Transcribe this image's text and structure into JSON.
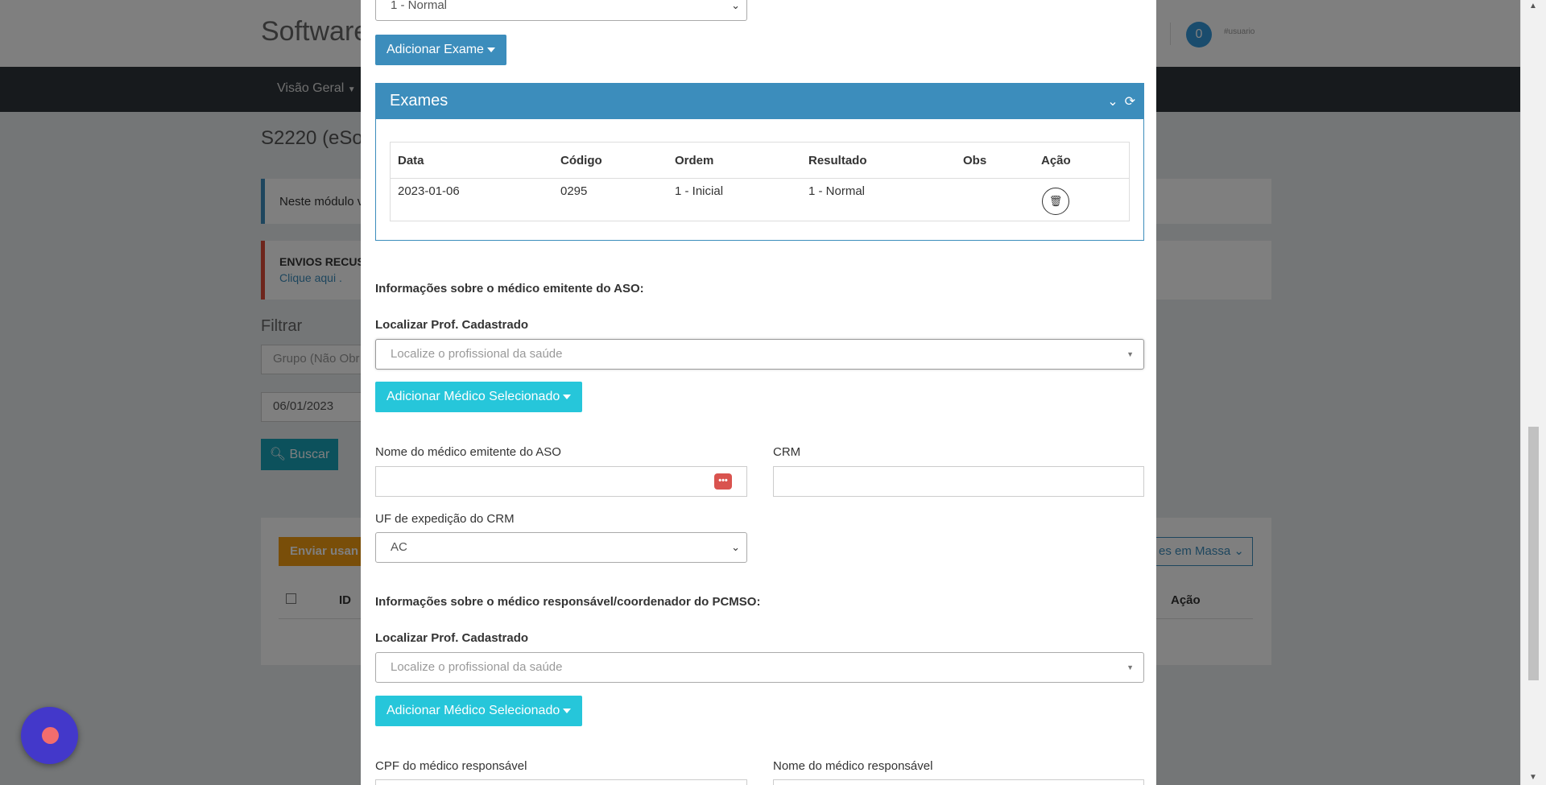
{
  "background": {
    "brand": "Software",
    "notif_count": "0",
    "user_label": "#usuario",
    "nav_item": "Visão Geral",
    "page_title": "S2220 (eSo",
    "info_text": "Neste módulo v",
    "alert_title": "ENVIOS RECUS",
    "alert_link": "Clique aqui .",
    "filter_title": "Filtrar",
    "group_placeholder": "Grupo (Não Obr",
    "date_value": "06/01/2023",
    "search_button": "Buscar",
    "send_button": "Enviar usan",
    "mass_button": "es em Massa",
    "col_id": "ID",
    "col_action": "Ação"
  },
  "modal": {
    "result_select": "1 - Normal",
    "add_exam_button": "Adicionar Exame",
    "exams_box": {
      "title": "Exames",
      "columns": [
        "Data",
        "Código",
        "Ordem",
        "Resultado",
        "Obs",
        "Ação"
      ],
      "rows": [
        {
          "data": "2023-01-06",
          "codigo": "0295",
          "ordem": "1 - Inicial",
          "resultado": "1 - Normal",
          "obs": ""
        }
      ]
    },
    "emitter_section": {
      "title": "Informações sobre o médico emitente do ASO:",
      "search_label": "Localizar Prof. Cadastrado",
      "search_placeholder": "Localize o profissional da saúde",
      "add_button": "Adicionar Médico Selecionado",
      "name_label": "Nome do médico emitente do ASO",
      "name_value": "",
      "crm_label": "CRM",
      "crm_value": "",
      "uf_label": "UF de expedição do CRM",
      "uf_value": "AC"
    },
    "coordinator_section": {
      "title": "Informações sobre o médico responsável/coordenador do PCMSO:",
      "search_label": "Localizar Prof. Cadastrado",
      "search_placeholder": "Localize o profissional da saúde",
      "add_button": "Adicionar Médico Selecionado",
      "cpf_label": "CPF do médico responsável",
      "name_label": "Nome do médico responsável"
    }
  },
  "colors": {
    "primary": "#3c8dbc",
    "teal": "#26c6da",
    "danger": "#d9534f",
    "chat": "#4338ca"
  }
}
